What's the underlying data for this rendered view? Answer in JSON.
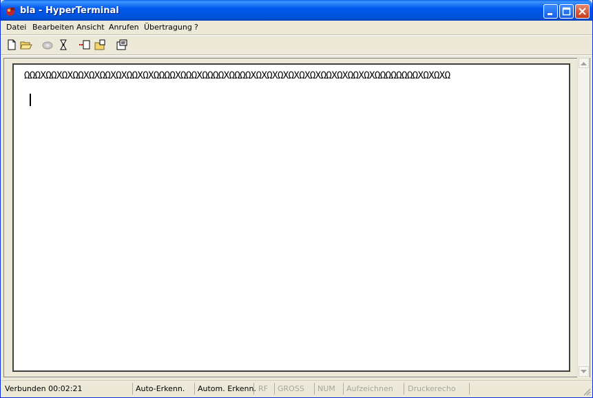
{
  "window": {
    "title": "bla - HyperTerminal"
  },
  "menu": [
    "Datei",
    "Bearbeiten",
    "Ansicht",
    "Anrufen",
    "Übertragung",
    "?"
  ],
  "toolbar_icons": [
    "new-document-icon",
    "open-folder-icon",
    "disconnected-phone-icon",
    "dial-icon",
    "send-file-icon",
    "receive-file-icon",
    "properties-icon"
  ],
  "terminal": {
    "line1": "ΩΩΩXΩΩXΩXΩΩXΩXΩΩXΩXΩΩXΩXΩΩΩΩXΩΩΩXΩΩΩΩXΩΩΩΩXΩXΩXΩXΩXΩXΩXΩΩXΩXΩΩXΩXΩΩΩΩΩΩΩΩXΩXΩXΩ"
  },
  "status": {
    "connected": "Verbunden 00:02:21",
    "detect1": "Auto-Erkenn.",
    "detect2": "Autom. Erkenn.",
    "rf": "RF",
    "caps": "GROSS",
    "num": "NUM",
    "capture": "Aufzeichnen",
    "print_echo": "Druckerecho"
  },
  "colors": {
    "titlebar": "#0058ee",
    "chrome": "#ece9d8",
    "close": "#c5391a"
  }
}
